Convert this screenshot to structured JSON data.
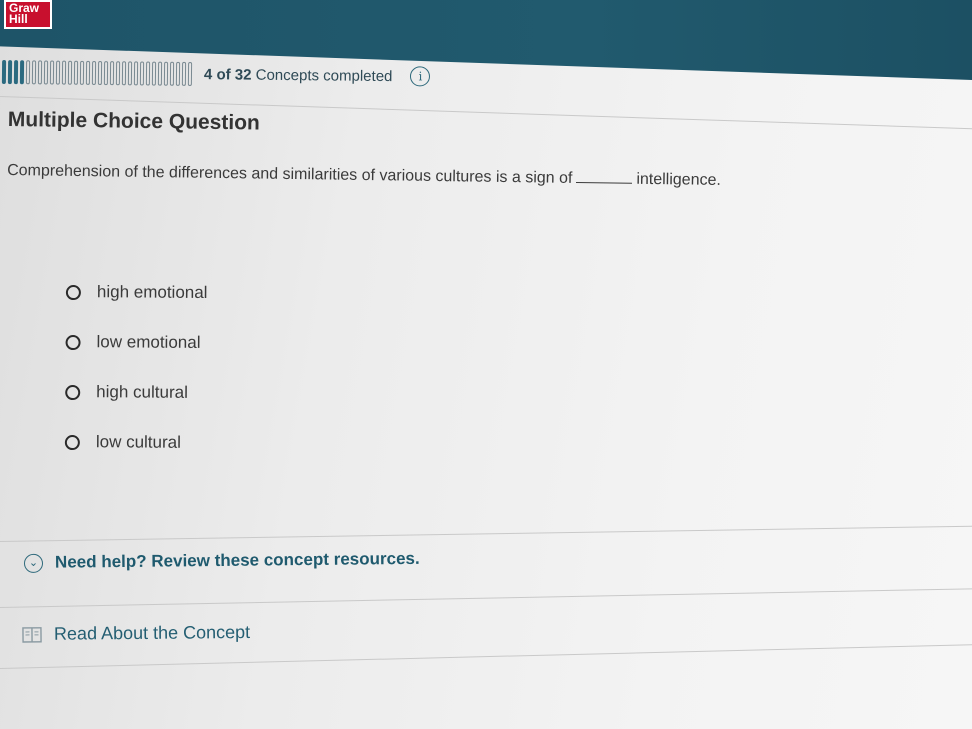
{
  "header": {
    "logo_line1": "Graw",
    "logo_line2": "Hill"
  },
  "progress": {
    "completed": 4,
    "total": 32,
    "count_text": "4 of 32",
    "label": "Concepts completed",
    "info_icon": "info-icon"
  },
  "question": {
    "type_label": "Multiple Choice Question",
    "text_before": "Comprehension of the differences and similarities of various cultures is a sign of",
    "text_after": "intelligence.",
    "options": [
      {
        "label": "high emotional"
      },
      {
        "label": "low emotional"
      },
      {
        "label": "high cultural"
      },
      {
        "label": "low cultural"
      }
    ]
  },
  "help": {
    "icon": "chevron-down-icon",
    "text": "Need help? Review these concept resources."
  },
  "resources": {
    "icon": "book-icon",
    "read_label": "Read About the Concept"
  },
  "colors": {
    "header_band": "#1e5468",
    "brand_red": "#c8102e",
    "accent_teal": "#1f5a6e"
  }
}
